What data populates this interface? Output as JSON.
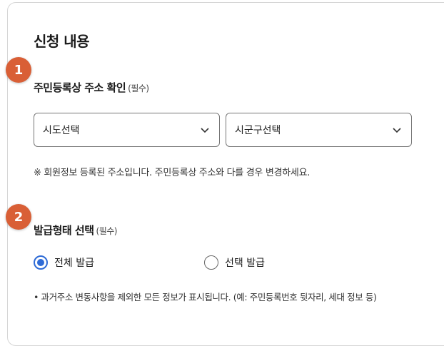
{
  "section_title": "신청 내용",
  "steps": [
    {
      "number": "1",
      "label": "주민등록상 주소 확인",
      "required": "(필수)"
    },
    {
      "number": "2",
      "label": "발급형태 선택",
      "required": "(필수)"
    }
  ],
  "address": {
    "province_select": {
      "value": "시도선택",
      "icon": "chevron-down-icon"
    },
    "district_select": {
      "value": "시군구선택",
      "icon": "chevron-down-icon"
    },
    "note": "※ 회원정보 등록된 주소입니다. 주민등록상 주소와 다를 경우 변경하세요."
  },
  "issue_type": {
    "options": [
      {
        "label": "전체 발급",
        "selected": true
      },
      {
        "label": "선택 발급",
        "selected": false
      }
    ],
    "note": "• 과거주소 변동사항을 제외한 모든 정보가 표시됩니다. (예: 주민등록번호 뒷자리, 세대 정보 등)"
  },
  "colors": {
    "step_badge": "#d95f36",
    "radio_selected": "#2e6bd6",
    "border": "#d6d6d6"
  }
}
